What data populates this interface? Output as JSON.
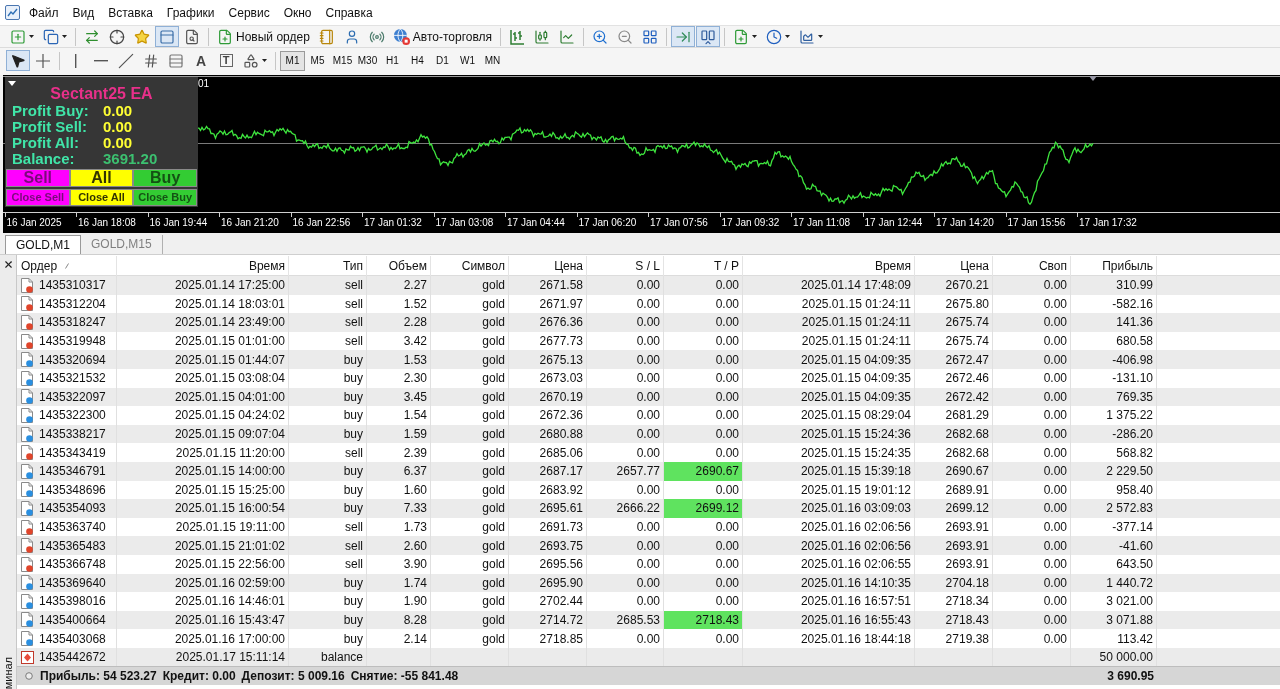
{
  "menu": [
    "Файл",
    "Вид",
    "Вставка",
    "Графики",
    "Сервис",
    "Окно",
    "Справка"
  ],
  "toolbar": [
    [
      {
        "kind": "new_chart",
        "pressed": false,
        "caret": true
      },
      {
        "kind": "profiles",
        "pressed": false,
        "caret": true
      }
    ],
    [
      {
        "kind": "market_watch",
        "pressed": false,
        "caret": false
      },
      {
        "kind": "data_window",
        "pressed": false,
        "caret": false
      },
      {
        "kind": "navigator",
        "pressed": false,
        "caret": false
      },
      {
        "kind": "terminal",
        "pressed": true,
        "caret": false
      },
      {
        "kind": "tester",
        "pressed": false,
        "caret": false
      }
    ],
    [
      {
        "kind": "new_order",
        "label": "Новый ордер",
        "pressed": false,
        "caret": false
      },
      {
        "kind": "metaeditor",
        "pressed": false,
        "caret": false
      },
      {
        "kind": "community",
        "pressed": false,
        "caret": false
      },
      {
        "kind": "signals",
        "pressed": false,
        "caret": false
      },
      {
        "kind": "auto_trading",
        "label": "Авто-торговля",
        "pressed": false,
        "caret": false
      }
    ],
    [
      {
        "kind": "bars",
        "pressed": false,
        "caret": false
      },
      {
        "kind": "candles",
        "pressed": false,
        "caret": false
      },
      {
        "kind": "line",
        "pressed": false,
        "caret": false
      }
    ],
    [
      {
        "kind": "zoom_in",
        "pressed": false,
        "caret": false
      },
      {
        "kind": "zoom_out",
        "pressed": false,
        "caret": false
      },
      {
        "kind": "tile",
        "pressed": false,
        "caret": false
      }
    ],
    [
      {
        "kind": "autoscroll",
        "pressed": true,
        "caret": false
      },
      {
        "kind": "chart_shift",
        "pressed": true,
        "caret": false
      }
    ],
    [
      {
        "kind": "indicators",
        "pressed": false,
        "caret": true
      },
      {
        "kind": "periods",
        "pressed": false,
        "caret": true
      },
      {
        "kind": "templates",
        "pressed": false,
        "caret": true
      }
    ]
  ],
  "drawing_toolbar": [
    [
      {
        "kind": "cursor",
        "pressed": true,
        "caret": false
      },
      {
        "kind": "crosshair",
        "pressed": false,
        "caret": false
      }
    ],
    [
      {
        "kind": "vertical_line",
        "pressed": false,
        "caret": false
      },
      {
        "kind": "horizontal_line",
        "pressed": false,
        "caret": false
      },
      {
        "kind": "trendline",
        "pressed": false,
        "caret": false
      },
      {
        "kind": "channel",
        "pressed": false,
        "caret": false
      },
      {
        "kind": "fibo",
        "pressed": false,
        "caret": false
      },
      {
        "kind": "text",
        "glyph": "A",
        "pressed": false,
        "caret": false
      },
      {
        "kind": "label",
        "glyph": "T",
        "pressed": false,
        "caret": false
      },
      {
        "kind": "arrows",
        "pressed": false,
        "caret": true
      }
    ]
  ],
  "periods": [
    {
      "label": "M1",
      "selected": true
    },
    {
      "label": "M5",
      "selected": false
    },
    {
      "label": "M15",
      "selected": false
    },
    {
      "label": "M30",
      "selected": false
    },
    {
      "label": "H1",
      "selected": false
    },
    {
      "label": "H4",
      "selected": false
    },
    {
      "label": "D1",
      "selected": false
    },
    {
      "label": "W1",
      "selected": false
    },
    {
      "label": "MN",
      "selected": false
    }
  ],
  "chart": {
    "label_fragment": "01",
    "time_axis": [
      "16 Jan 2025",
      "16 Jan 18:08",
      "16 Jan 19:44",
      "16 Jan 21:20",
      "16 Jan 22:56",
      "17 Jan 01:32",
      "17 Jan 03:08",
      "17 Jan 04:44",
      "17 Jan 06:20",
      "17 Jan 07:56",
      "17 Jan 09:32",
      "17 Jan 11:08",
      "17 Jan 12:44",
      "17 Jan 14:20",
      "17 Jan 15:56",
      "17 Jan 17:32"
    ]
  },
  "ea_panel": {
    "title": "Sectant25 EA",
    "stats": [
      {
        "label": "Profit Buy:",
        "value": "0.00",
        "kind": "profit"
      },
      {
        "label": "Profit Sell:",
        "value": "0.00",
        "kind": "profit"
      },
      {
        "label": "Profit All:",
        "value": "0.00",
        "kind": "profit"
      },
      {
        "label": "Balance:",
        "value": "3691.20",
        "kind": "balance"
      }
    ],
    "buttons": [
      {
        "label": "Sell",
        "kind": "sell"
      },
      {
        "label": "All",
        "kind": "all"
      },
      {
        "label": "Buy",
        "kind": "buy"
      }
    ],
    "close_buttons": [
      {
        "label": "Close Sell",
        "kind": "sell"
      },
      {
        "label": "Close All",
        "kind": "all"
      },
      {
        "label": "Close Buy",
        "kind": "buy"
      }
    ]
  },
  "chart_tabs": [
    {
      "label": "GOLD,M1",
      "selected": true
    },
    {
      "label": "GOLD,M15",
      "selected": false
    }
  ],
  "terminal": {
    "side_label": "минал",
    "columns": [
      {
        "label": "Ордер",
        "sorted": true
      },
      {
        "label": "Время",
        "sorted": false
      },
      {
        "label": "Тип",
        "sorted": false
      },
      {
        "label": "Объем",
        "sorted": false
      },
      {
        "label": "Символ",
        "sorted": false
      },
      {
        "label": "Цена",
        "sorted": false
      },
      {
        "label": "S / L",
        "sorted": false
      },
      {
        "label": "T / P",
        "sorted": false
      },
      {
        "label": "Время",
        "sorted": false
      },
      {
        "label": "Цена",
        "sorted": false
      },
      {
        "label": "Своп",
        "sorted": false
      },
      {
        "label": "Прибыль",
        "sorted": false
      }
    ],
    "rows": [
      {
        "kind": "sell",
        "order": "1435310317",
        "open_time": "2025.01.14 17:25:00",
        "type": "sell",
        "volume": "2.27",
        "symbol": "gold",
        "open_price": "2671.58",
        "sl": "0.00",
        "tp": "0.00",
        "close_time": "2025.01.14 17:48:09",
        "close_price": "2670.21",
        "swap": "0.00",
        "profit": "310.99",
        "tp_hit": false
      },
      {
        "kind": "sell",
        "order": "1435312204",
        "open_time": "2025.01.14 18:03:01",
        "type": "sell",
        "volume": "1.52",
        "symbol": "gold",
        "open_price": "2671.97",
        "sl": "0.00",
        "tp": "0.00",
        "close_time": "2025.01.15 01:24:11",
        "close_price": "2675.80",
        "swap": "0.00",
        "profit": "-582.16",
        "tp_hit": false
      },
      {
        "kind": "sell",
        "order": "1435318247",
        "open_time": "2025.01.14 23:49:00",
        "type": "sell",
        "volume": "2.28",
        "symbol": "gold",
        "open_price": "2676.36",
        "sl": "0.00",
        "tp": "0.00",
        "close_time": "2025.01.15 01:24:11",
        "close_price": "2675.74",
        "swap": "0.00",
        "profit": "141.36",
        "tp_hit": false
      },
      {
        "kind": "sell",
        "order": "1435319948",
        "open_time": "2025.01.15 01:01:00",
        "type": "sell",
        "volume": "3.42",
        "symbol": "gold",
        "open_price": "2677.73",
        "sl": "0.00",
        "tp": "0.00",
        "close_time": "2025.01.15 01:24:11",
        "close_price": "2675.74",
        "swap": "0.00",
        "profit": "680.58",
        "tp_hit": false
      },
      {
        "kind": "buy",
        "order": "1435320694",
        "open_time": "2025.01.15 01:44:07",
        "type": "buy",
        "volume": "1.53",
        "symbol": "gold",
        "open_price": "2675.13",
        "sl": "0.00",
        "tp": "0.00",
        "close_time": "2025.01.15 04:09:35",
        "close_price": "2672.47",
        "swap": "0.00",
        "profit": "-406.98",
        "tp_hit": false
      },
      {
        "kind": "buy",
        "order": "1435321532",
        "open_time": "2025.01.15 03:08:04",
        "type": "buy",
        "volume": "2.30",
        "symbol": "gold",
        "open_price": "2673.03",
        "sl": "0.00",
        "tp": "0.00",
        "close_time": "2025.01.15 04:09:35",
        "close_price": "2672.46",
        "swap": "0.00",
        "profit": "-131.10",
        "tp_hit": false
      },
      {
        "kind": "buy",
        "order": "1435322097",
        "open_time": "2025.01.15 04:01:00",
        "type": "buy",
        "volume": "3.45",
        "symbol": "gold",
        "open_price": "2670.19",
        "sl": "0.00",
        "tp": "0.00",
        "close_time": "2025.01.15 04:09:35",
        "close_price": "2672.42",
        "swap": "0.00",
        "profit": "769.35",
        "tp_hit": false
      },
      {
        "kind": "buy",
        "order": "1435322300",
        "open_time": "2025.01.15 04:24:02",
        "type": "buy",
        "volume": "1.54",
        "symbol": "gold",
        "open_price": "2672.36",
        "sl": "0.00",
        "tp": "0.00",
        "close_time": "2025.01.15 08:29:04",
        "close_price": "2681.29",
        "swap": "0.00",
        "profit": "1 375.22",
        "tp_hit": false
      },
      {
        "kind": "buy",
        "order": "1435338217",
        "open_time": "2025.01.15 09:07:04",
        "type": "buy",
        "volume": "1.59",
        "symbol": "gold",
        "open_price": "2680.88",
        "sl": "0.00",
        "tp": "0.00",
        "close_time": "2025.01.15 15:24:36",
        "close_price": "2682.68",
        "swap": "0.00",
        "profit": "-286.20",
        "tp_hit": false
      },
      {
        "kind": "sell",
        "order": "1435343419",
        "open_time": "2025.01.15 11:20:00",
        "type": "sell",
        "volume": "2.39",
        "symbol": "gold",
        "open_price": "2685.06",
        "sl": "0.00",
        "tp": "0.00",
        "close_time": "2025.01.15 15:24:35",
        "close_price": "2682.68",
        "swap": "0.00",
        "profit": "568.82",
        "tp_hit": false
      },
      {
        "kind": "buy",
        "order": "1435346791",
        "open_time": "2025.01.15 14:00:00",
        "type": "buy",
        "volume": "6.37",
        "symbol": "gold",
        "open_price": "2687.17",
        "sl": "2657.77",
        "tp": "2690.67",
        "close_time": "2025.01.15 15:39:18",
        "close_price": "2690.67",
        "swap": "0.00",
        "profit": "2 229.50",
        "tp_hit": true
      },
      {
        "kind": "buy",
        "order": "1435348696",
        "open_time": "2025.01.15 15:25:00",
        "type": "buy",
        "volume": "1.60",
        "symbol": "gold",
        "open_price": "2683.92",
        "sl": "0.00",
        "tp": "0.00",
        "close_time": "2025.01.15 19:01:12",
        "close_price": "2689.91",
        "swap": "0.00",
        "profit": "958.40",
        "tp_hit": false
      },
      {
        "kind": "buy",
        "order": "1435354093",
        "open_time": "2025.01.15 16:00:54",
        "type": "buy",
        "volume": "7.33",
        "symbol": "gold",
        "open_price": "2695.61",
        "sl": "2666.22",
        "tp": "2699.12",
        "close_time": "2025.01.16 03:09:03",
        "close_price": "2699.12",
        "swap": "0.00",
        "profit": "2 572.83",
        "tp_hit": true
      },
      {
        "kind": "sell",
        "order": "1435363740",
        "open_time": "2025.01.15 19:11:00",
        "type": "sell",
        "volume": "1.73",
        "symbol": "gold",
        "open_price": "2691.73",
        "sl": "0.00",
        "tp": "0.00",
        "close_time": "2025.01.16 02:06:56",
        "close_price": "2693.91",
        "swap": "0.00",
        "profit": "-377.14",
        "tp_hit": false
      },
      {
        "kind": "sell",
        "order": "1435365483",
        "open_time": "2025.01.15 21:01:02",
        "type": "sell",
        "volume": "2.60",
        "symbol": "gold",
        "open_price": "2693.75",
        "sl": "0.00",
        "tp": "0.00",
        "close_time": "2025.01.16 02:06:56",
        "close_price": "2693.91",
        "swap": "0.00",
        "profit": "-41.60",
        "tp_hit": false
      },
      {
        "kind": "sell",
        "order": "1435366748",
        "open_time": "2025.01.15 22:56:00",
        "type": "sell",
        "volume": "3.90",
        "symbol": "gold",
        "open_price": "2695.56",
        "sl": "0.00",
        "tp": "0.00",
        "close_time": "2025.01.16 02:06:55",
        "close_price": "2693.91",
        "swap": "0.00",
        "profit": "643.50",
        "tp_hit": false
      },
      {
        "kind": "buy",
        "order": "1435369640",
        "open_time": "2025.01.16 02:59:00",
        "type": "buy",
        "volume": "1.74",
        "symbol": "gold",
        "open_price": "2695.90",
        "sl": "0.00",
        "tp": "0.00",
        "close_time": "2025.01.16 14:10:35",
        "close_price": "2704.18",
        "swap": "0.00",
        "profit": "1 440.72",
        "tp_hit": false
      },
      {
        "kind": "buy",
        "order": "1435398016",
        "open_time": "2025.01.16 14:46:01",
        "type": "buy",
        "volume": "1.90",
        "symbol": "gold",
        "open_price": "2702.44",
        "sl": "0.00",
        "tp": "0.00",
        "close_time": "2025.01.16 16:57:51",
        "close_price": "2718.34",
        "swap": "0.00",
        "profit": "3 021.00",
        "tp_hit": false
      },
      {
        "kind": "buy",
        "order": "1435400664",
        "open_time": "2025.01.16 15:43:47",
        "type": "buy",
        "volume": "8.28",
        "symbol": "gold",
        "open_price": "2714.72",
        "sl": "2685.53",
        "tp": "2718.43",
        "close_time": "2025.01.16 16:55:43",
        "close_price": "2718.43",
        "swap": "0.00",
        "profit": "3 071.88",
        "tp_hit": true
      },
      {
        "kind": "buy",
        "order": "1435403068",
        "open_time": "2025.01.16 17:00:00",
        "type": "buy",
        "volume": "2.14",
        "symbol": "gold",
        "open_price": "2718.85",
        "sl": "0.00",
        "tp": "0.00",
        "close_time": "2025.01.16 18:44:18",
        "close_price": "2719.38",
        "swap": "0.00",
        "profit": "113.42",
        "tp_hit": false
      },
      {
        "kind": "balance",
        "order": "1435442672",
        "open_time": "2025.01.17 15:11:14",
        "type": "balance",
        "profit": "50 000.00"
      }
    ],
    "summary": {
      "items": [
        "Прибыль: 54 523.27",
        "Кредит: 0.00",
        "Депозит: 5 009.16",
        "Снятие: -55 841.48"
      ],
      "total": "3 690.95"
    }
  }
}
